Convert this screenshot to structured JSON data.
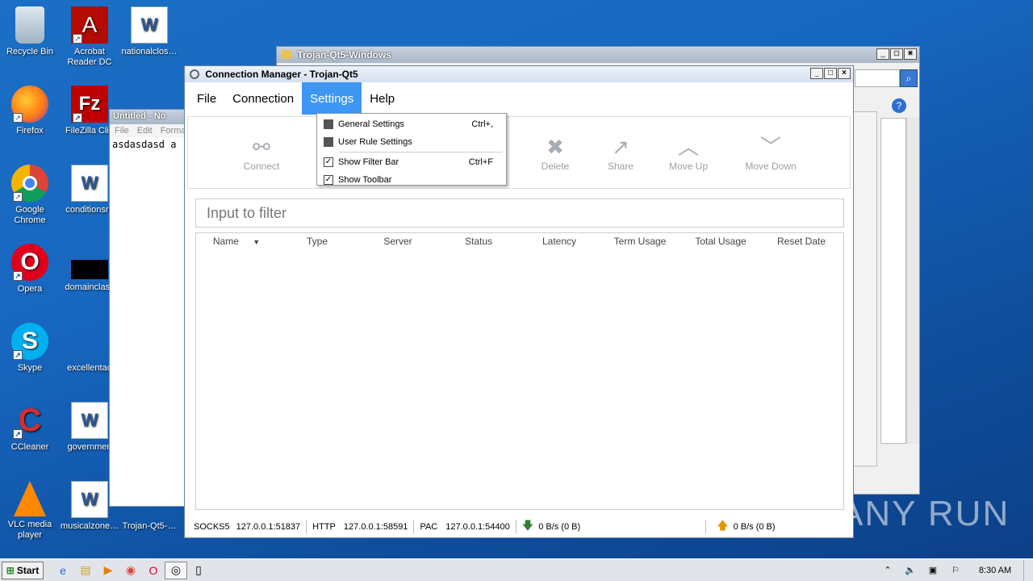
{
  "desktop": {
    "icons": [
      {
        "label": "Recycle Bin",
        "glyph": "🗑"
      },
      {
        "label": "Acrobat Reader DC",
        "glyph": "A"
      },
      {
        "label": "nationalclos…",
        "glyph": "W"
      },
      {
        "label": "Firefox",
        "glyph": "🦊"
      },
      {
        "label": "FileZilla Clie",
        "glyph": "Fz"
      },
      {
        "label": "Google Chrome",
        "glyph": "◉"
      },
      {
        "label": "conditionsre",
        "glyph": "W"
      },
      {
        "label": "Opera",
        "glyph": "O"
      },
      {
        "label": "domainclass",
        "glyph": ""
      },
      {
        "label": "Skype",
        "glyph": "S"
      },
      {
        "label": "excellentad",
        "glyph": ""
      },
      {
        "label": "CCleaner",
        "glyph": "C"
      },
      {
        "label": "governmen",
        "glyph": "W"
      },
      {
        "label": "VLC media player",
        "glyph": "▲"
      },
      {
        "label": "musicalzone…",
        "glyph": "W"
      },
      {
        "label": "Trojan-Qt5-…",
        "glyph": ""
      }
    ]
  },
  "explorer_window": {
    "title": "Trojan-Qt5-Windows"
  },
  "notepad": {
    "title": "Untitled - No",
    "menu": [
      "File",
      "Edit",
      "Forma"
    ],
    "content": "asdasdasd a"
  },
  "app": {
    "title": "Connection Manager - Trojan-Qt5",
    "menu": [
      "File",
      "Connection",
      "Settings",
      "Help"
    ],
    "toolbar": [
      {
        "label": "Connect",
        "icon": "link-icon"
      },
      {
        "label": "Delete",
        "icon": "x-icon"
      },
      {
        "label": "Share",
        "icon": "share-icon"
      },
      {
        "label": "Move Up",
        "icon": "chevron-up-icon"
      },
      {
        "label": "Move Down",
        "icon": "chevron-down-icon"
      }
    ],
    "filter_placeholder": "Input to filter",
    "columns": [
      "Name",
      "Type",
      "Server",
      "Status",
      "Latency",
      "Term Usage",
      "Total Usage",
      "Reset Date"
    ],
    "status": {
      "socks_label": "SOCKS5",
      "socks_addr": "127.0.0.1:51837",
      "http_label": "HTTP",
      "http_addr": "127.0.0.1:58591",
      "pac_label": "PAC",
      "pac_addr": "127.0.0.1:54400",
      "down": "0 B/s (0 B)",
      "up": "0 B/s (0 B)"
    },
    "settings_menu": [
      {
        "label": "General Settings",
        "shortcut": "Ctrl+,",
        "checked": null
      },
      {
        "label": "User Rule Settings",
        "shortcut": "",
        "checked": null
      },
      {
        "label": "Show Filter Bar",
        "shortcut": "Ctrl+F",
        "checked": true
      },
      {
        "label": "Show Toolbar",
        "shortcut": "",
        "checked": true
      }
    ]
  },
  "taskbar": {
    "start_label": "Start",
    "clock": "8:30 AM"
  },
  "watermark": "ANY RUN",
  "colors": {
    "menu_active": "#3d97f2",
    "desktop": "#1767c0"
  }
}
